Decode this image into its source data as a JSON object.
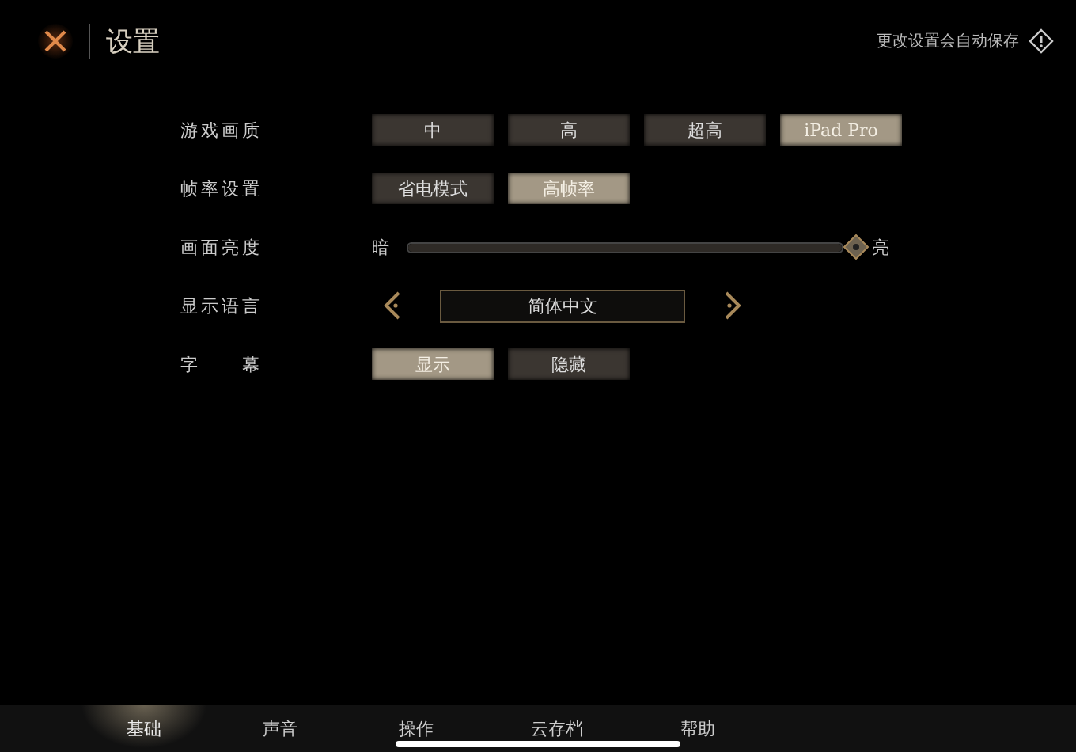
{
  "header": {
    "title": "设置",
    "notice": "更改设置会自动保存"
  },
  "settings": [
    {
      "kind": "options",
      "label": "游戏画质",
      "options": [
        {
          "label": "中",
          "selected": false
        },
        {
          "label": "高",
          "selected": false
        },
        {
          "label": "超高",
          "selected": false
        },
        {
          "label": "iPad Pro",
          "selected": true
        }
      ]
    },
    {
      "kind": "options",
      "label": "帧率设置",
      "options": [
        {
          "label": "省电模式",
          "selected": false
        },
        {
          "label": "高帧率",
          "selected": true
        }
      ]
    },
    {
      "kind": "slider",
      "label": "画面亮度",
      "min_label": "暗",
      "max_label": "亮",
      "level": 1
    },
    {
      "kind": "selector",
      "label": "显示语言",
      "value": "简体中文"
    },
    {
      "kind": "options",
      "label": "字　幕",
      "options": [
        {
          "label": "显示",
          "selected": true
        },
        {
          "label": "隐藏",
          "selected": false
        }
      ]
    }
  ],
  "tabs": [
    {
      "label": "基础",
      "selected": true
    },
    {
      "label": "声音",
      "selected": false
    },
    {
      "label": "操作",
      "selected": false
    },
    {
      "label": "云存档",
      "selected": false
    },
    {
      "label": "帮助",
      "selected": false
    }
  ]
}
